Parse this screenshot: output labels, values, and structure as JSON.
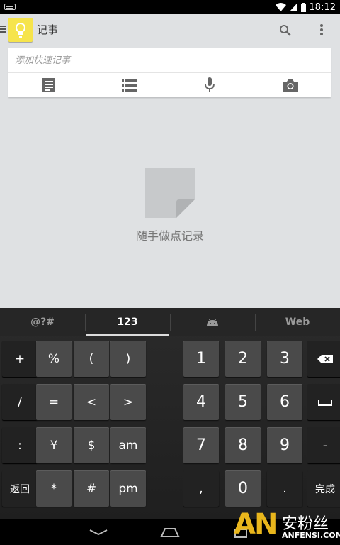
{
  "status_bar": {
    "time": "18:12"
  },
  "app": {
    "title": "记事",
    "quick_note_placeholder": "添加快速记事",
    "empty_message": "随手做点记录"
  },
  "keyboard": {
    "tabs": [
      "@?#",
      "123",
      "",
      "Web"
    ],
    "active_tab": "123",
    "rows": [
      [
        "+",
        "%",
        "(",
        ")",
        "1",
        "2",
        "3"
      ],
      [
        "/",
        "=",
        "<",
        ">",
        "4",
        "5",
        "6"
      ],
      [
        ":",
        "¥",
        "$",
        "am",
        "7",
        "8",
        "9",
        "-"
      ],
      [
        "返回",
        "*",
        "#",
        "pm",
        ",",
        "0",
        ".",
        "完成"
      ]
    ]
  },
  "watermark": {
    "logo": "AN",
    "cn": "安粉丝",
    "en": "ANFENSI.COM"
  },
  "colors": {
    "app_bg": "#dfe1e3",
    "keep_yellow": "#f6e44c",
    "key_bg": "#4a4a4a",
    "watermark_gold": "#e9b61c"
  }
}
